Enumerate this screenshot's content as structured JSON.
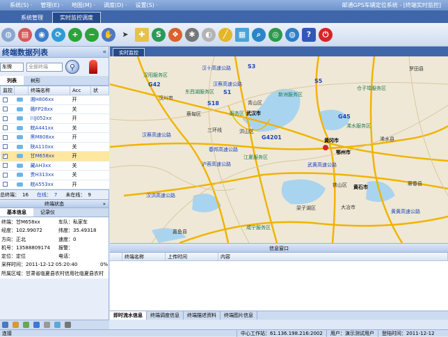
{
  "menu": {
    "items": [
      "系统(S) ·",
      "管理(E) ·",
      "地图(M) ·",
      "调度(D) ·",
      "设置(S) ·"
    ],
    "app_title": "邮通GPS车辆定位系统 - [终端实时监控]"
  },
  "tabs": [
    "系统管理",
    "实时监控调度"
  ],
  "toolbar_icons": [
    "globe-icon",
    "car-list-icon",
    "map-icon",
    "refresh-icon",
    "zoom-in-icon",
    "zoom-out-icon",
    "hand-icon",
    "pointer-icon",
    "add-point-icon",
    "settings-icon",
    "layers-icon",
    "tool-icon",
    "dashboard-icon",
    "measure-icon",
    "grid-icon",
    "search-map-icon",
    "world-icon",
    "earth-icon",
    "shield-icon",
    "power-icon"
  ],
  "left": {
    "title": "终端数据列表",
    "filter_label": "车牌",
    "filter_value": "全部终端",
    "subtabs": [
      "列表",
      "树形"
    ],
    "columns": [
      "监控",
      "",
      "终端名称",
      "Acc",
      "状"
    ],
    "rows": [
      {
        "name": "湘H806xx",
        "acc": "开",
        "checked": false,
        "selected": false
      },
      {
        "name": "赣FP28xx",
        "acc": "关",
        "checked": false,
        "selected": false
      },
      {
        "name": "川J052xx",
        "acc": "开",
        "checked": false,
        "selected": false
      },
      {
        "name": "皖A441xx",
        "acc": "关",
        "checked": false,
        "selected": false
      },
      {
        "name": "黑M808xx",
        "acc": "开",
        "checked": false,
        "selected": false
      },
      {
        "name": "陕A110xx",
        "acc": "关",
        "checked": false,
        "selected": false
      },
      {
        "name": "甘M658xx",
        "acc": "开",
        "checked": true,
        "selected": true
      },
      {
        "name": "藏AH3xx",
        "acc": "关",
        "checked": false,
        "selected": false
      },
      {
        "name": "贵H313xx",
        "acc": "关",
        "checked": false,
        "selected": false
      },
      {
        "name": "皖A553xx",
        "acc": "开",
        "checked": false,
        "selected": false
      }
    ],
    "totals": {
      "total_label": "总终端：",
      "total": "16",
      "online_label": "在线：",
      "online": "7",
      "offline_label": "未在线：",
      "offline": "9"
    },
    "status_title": "终端状态",
    "detail_tabs": [
      "基本信息",
      "记录仪"
    ],
    "details": [
      [
        "终端：甘M658xx",
        "车队：私家车"
      ],
      [
        "经度：102.99072",
        "纬度：35.49318"
      ],
      [
        "方向：正北",
        "速度：0"
      ],
      [
        "机号：13588809174",
        "报警："
      ],
      [
        "定位：定位",
        "电话："
      ],
      [
        "采样时间：2011-12-12 05:20:40",
        "0%"
      ],
      [
        "所属区域：甘肃省临夏县农村信用社临夏县农村",
        ""
      ]
    ]
  },
  "map": {
    "tab": "实时监控",
    "labels": [
      {
        "t": "汉阳服务区",
        "k": "svc"
      },
      {
        "t": "汉十高速公路",
        "k": "hwy"
      },
      {
        "t": "S3",
        "k": "road"
      },
      {
        "t": "G42",
        "k": "road"
      },
      {
        "t": "汉蔡高速公路",
        "k": "hwy"
      },
      {
        "t": "S5",
        "k": "road"
      },
      {
        "t": "罗田县",
        "k": ""
      },
      {
        "t": "仓子埠服务区",
        "k": "svc"
      },
      {
        "t": "汉川市",
        "k": ""
      },
      {
        "t": "东西湖服务区",
        "k": "svc"
      },
      {
        "t": "S1",
        "k": "road"
      },
      {
        "t": "新洲服务区",
        "k": "svc"
      },
      {
        "t": "S18",
        "k": "road"
      },
      {
        "t": "青山区",
        "k": ""
      },
      {
        "t": "蔡甸区",
        "k": ""
      },
      {
        "t": "服务区",
        "k": "svc"
      },
      {
        "t": "武汉市",
        "k": "city"
      },
      {
        "t": "G45",
        "k": "road"
      },
      {
        "t": "三环线",
        "k": ""
      },
      {
        "t": "洪山区",
        "k": ""
      },
      {
        "t": "浠水服务区",
        "k": "svc"
      },
      {
        "t": "汉蔡高速公路",
        "k": "hwy"
      },
      {
        "t": "G4201",
        "k": "road"
      },
      {
        "t": "黄冈市",
        "k": "city"
      },
      {
        "t": "浠水县",
        "k": ""
      },
      {
        "t": "鄂州市",
        "k": "city"
      },
      {
        "t": "春邦高速公路",
        "k": "hwy"
      },
      {
        "t": "江夏服务区",
        "k": "svc"
      },
      {
        "t": "沪蓉高速公路",
        "k": "hwy"
      },
      {
        "t": "武黄高速公路",
        "k": "hwy"
      },
      {
        "t": "汉洪高速公路",
        "k": "hwy"
      },
      {
        "t": "黄石市",
        "k": "city"
      },
      {
        "t": "蕲春县",
        "k": ""
      },
      {
        "t": "铁山区",
        "k": ""
      },
      {
        "t": "梁子湖区",
        "k": ""
      },
      {
        "t": "大冶市",
        "k": ""
      },
      {
        "t": "黄黄高速公路",
        "k": "hwy"
      },
      {
        "t": "咸宁服务区",
        "k": "svc"
      },
      {
        "t": "嘉鱼县",
        "k": ""
      }
    ]
  },
  "info": {
    "title": "信息窗口",
    "columns": [
      "终端名称",
      "上传时间",
      "内容"
    ]
  },
  "bottom_tabs": [
    "即时流水信息",
    "终端调度信息",
    "终端描述资料",
    "终端图片信息"
  ],
  "status": {
    "left": "连接",
    "server": "中心工作站：61.136.198.216:2002",
    "user": "用户：演示测试用户",
    "login": "登陆时间：2011-12-12"
  }
}
